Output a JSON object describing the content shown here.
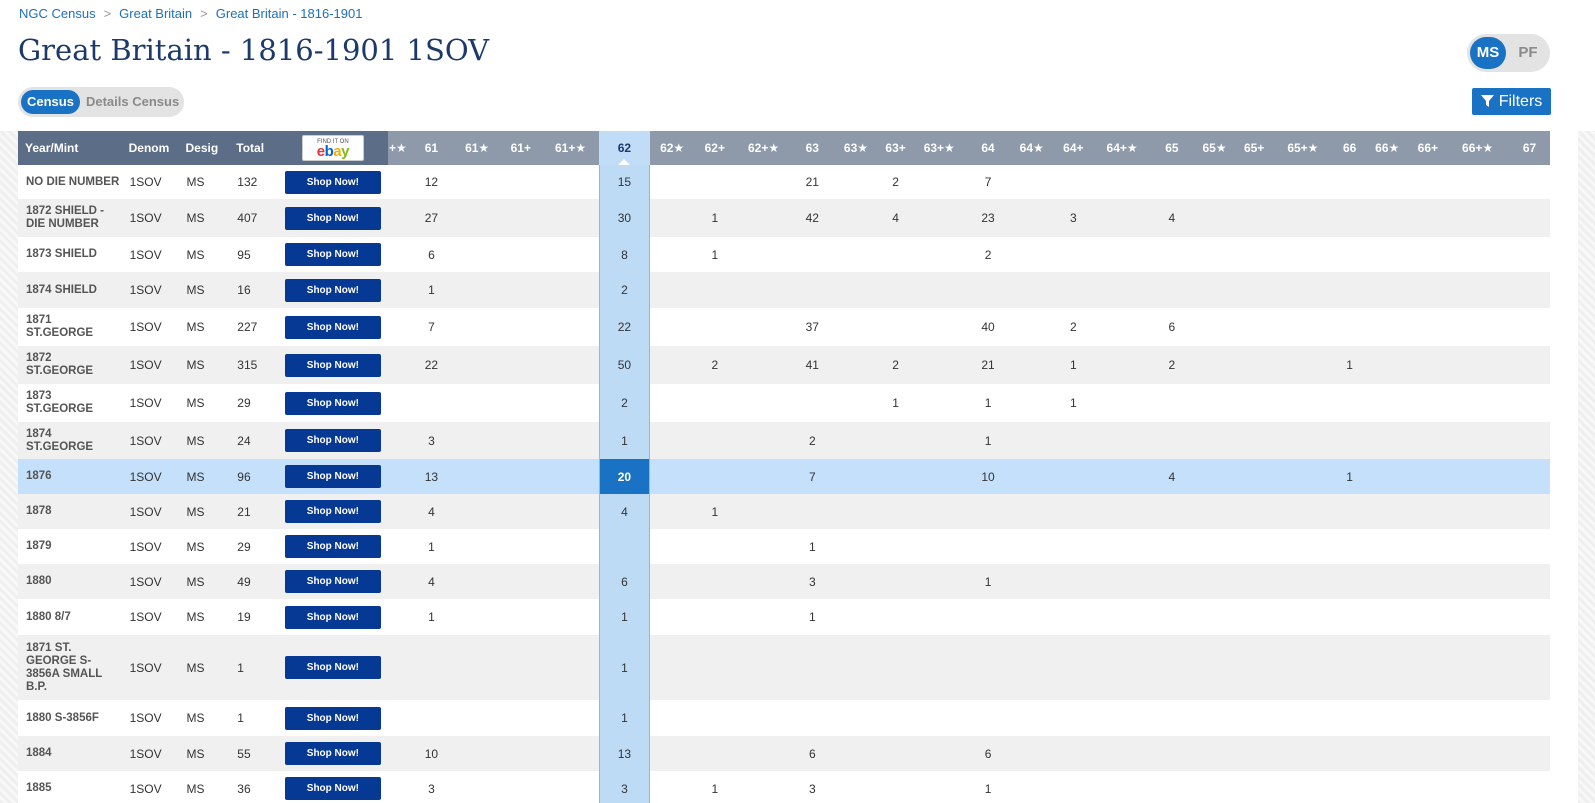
{
  "breadcrumb": [
    "NGC Census",
    "Great Britain",
    "Great Britain - 1816-1901"
  ],
  "breadcrumb_sep": ">",
  "title": "Great Britain - 1816-1901 1SOV",
  "census_tabs": [
    "Census",
    "Details Census"
  ],
  "active_census_tab": 0,
  "designation_toggle": [
    "MS",
    "PF"
  ],
  "active_designation": 0,
  "filters_label": "Filters",
  "ebay": {
    "find_label": "FIND IT ON",
    "logo": [
      "e",
      "b",
      "a",
      "y"
    ]
  },
  "colors": {
    "accent": "#1a72c4",
    "header_dark": "#5c6d88",
    "header": "#8e99aa",
    "shop": "#063994",
    "highlight_col": "#bedbf6"
  },
  "table": {
    "headers": [
      "Year/Mint",
      "Denom",
      "Desig",
      "Total"
    ],
    "grade_headers": [
      "+★",
      "61",
      "61★",
      "61+",
      "61+★",
      "62",
      "62★",
      "62+",
      "62+★",
      "63",
      "63★",
      "63+",
      "63+★",
      "64",
      "64★",
      "64+",
      "64+★",
      "65",
      "65★",
      "65+",
      "65+★",
      "66",
      "66★",
      "66+",
      "66+★",
      "67"
    ],
    "shop_label": "Shop Now!",
    "rows": [
      {
        "mint": "NO DIE NUMBER",
        "denom": "1SOV",
        "desig": "MS",
        "total": "132",
        "g": {
          "61": "12",
          "62": "15",
          "63": "21",
          "63+": "2",
          "64": "7"
        }
      },
      {
        "mint": "1872 SHIELD - DIE NUMBER",
        "denom": "1SOV",
        "desig": "MS",
        "total": "407",
        "g": {
          "61": "27",
          "62": "30",
          "62+": "1",
          "63": "42",
          "63+": "4",
          "64": "23",
          "64+": "3",
          "65": "4"
        }
      },
      {
        "mint": "1873 SHIELD",
        "denom": "1SOV",
        "desig": "MS",
        "total": "95",
        "g": {
          "61": "6",
          "62": "8",
          "62+": "1",
          "64": "2"
        }
      },
      {
        "mint": "1874 SHIELD",
        "denom": "1SOV",
        "desig": "MS",
        "total": "16",
        "g": {
          "61": "1",
          "62": "2"
        }
      },
      {
        "mint": "1871 ST.GEORGE",
        "denom": "1SOV",
        "desig": "MS",
        "total": "227",
        "g": {
          "61": "7",
          "62": "22",
          "63": "37",
          "64": "40",
          "64+": "2",
          "65": "6"
        }
      },
      {
        "mint": "1872 ST.GEORGE",
        "denom": "1SOV",
        "desig": "MS",
        "total": "315",
        "g": {
          "61": "22",
          "62": "50",
          "62+": "2",
          "63": "41",
          "63+": "2",
          "64": "21",
          "64+": "1",
          "65": "2",
          "66": "1"
        }
      },
      {
        "mint": "1873 ST.GEORGE",
        "denom": "1SOV",
        "desig": "MS",
        "total": "29",
        "g": {
          "62": "2",
          "63+": "1",
          "64": "1",
          "64+": "1"
        }
      },
      {
        "mint": "1874 ST.GEORGE",
        "denom": "1SOV",
        "desig": "MS",
        "total": "24",
        "g": {
          "61": "3",
          "62": "1",
          "63": "2",
          "64": "1"
        }
      },
      {
        "mint": "1876",
        "denom": "1SOV",
        "desig": "MS",
        "total": "96",
        "highlight": true,
        "g": {
          "61": "13",
          "62": "20",
          "63": "7",
          "64": "10",
          "65": "4",
          "66": "1"
        }
      },
      {
        "mint": "1878",
        "denom": "1SOV",
        "desig": "MS",
        "total": "21",
        "g": {
          "61": "4",
          "62": "4",
          "62+": "1"
        }
      },
      {
        "mint": "1879",
        "denom": "1SOV",
        "desig": "MS",
        "total": "29",
        "g": {
          "61": "1",
          "63": "1"
        }
      },
      {
        "mint": "1880",
        "denom": "1SOV",
        "desig": "MS",
        "total": "49",
        "g": {
          "61": "4",
          "62": "6",
          "63": "3",
          "64": "1"
        }
      },
      {
        "mint": "1880 8/7",
        "denom": "1SOV",
        "desig": "MS",
        "total": "19",
        "g": {
          "61": "1",
          "62": "1",
          "63": "1"
        }
      },
      {
        "mint": "1871 ST. GEORGE S-3856A SMALL B.P.",
        "denom": "1SOV",
        "desig": "MS",
        "total": "1",
        "g": {
          "62": "1"
        }
      },
      {
        "mint": "1880 S-3856F",
        "denom": "1SOV",
        "desig": "MS",
        "total": "1",
        "g": {
          "62": "1"
        }
      },
      {
        "mint": "1884",
        "denom": "1SOV",
        "desig": "MS",
        "total": "55",
        "g": {
          "61": "10",
          "62": "13",
          "63": "6",
          "64": "6"
        }
      },
      {
        "mint": "1885",
        "denom": "1SOV",
        "desig": "MS",
        "total": "36",
        "g": {
          "61": "3",
          "62": "3",
          "62+": "1",
          "63": "3",
          "64": "1"
        }
      }
    ]
  }
}
